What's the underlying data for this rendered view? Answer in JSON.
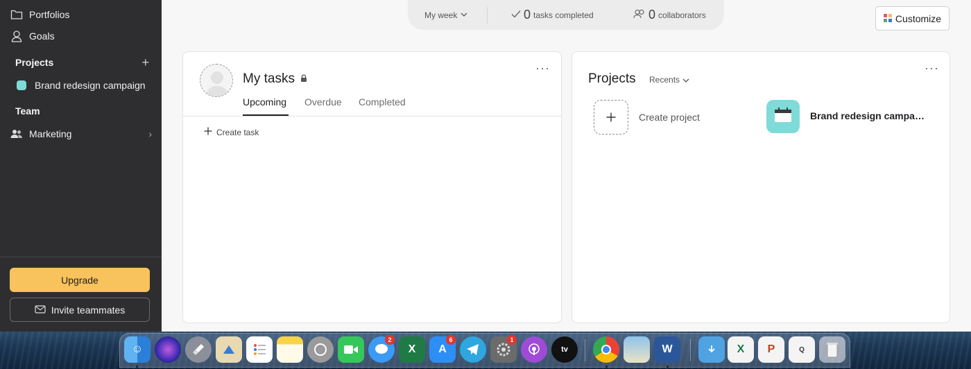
{
  "sidebar": {
    "portfolios": "Portfolios",
    "goals": "Goals",
    "projects_heading": "Projects",
    "project_item": "Brand redesign campaign",
    "team_heading": "Team",
    "team_item": "Marketing",
    "upgrade": "Upgrade",
    "invite": "Invite teammates"
  },
  "stats": {
    "period": "My week",
    "tasks_count": "0",
    "tasks_label": "tasks completed",
    "collab_count": "0",
    "collab_label": "collaborators"
  },
  "customize": "Customize",
  "my_tasks": {
    "title": "My tasks",
    "tabs": [
      "Upcoming",
      "Overdue",
      "Completed"
    ],
    "create_task": "Create task"
  },
  "projects_card": {
    "title": "Projects",
    "filter": "Recents",
    "create": "Create project",
    "project_name": "Brand redesign campaign",
    "project_color": "#7fdbd8"
  },
  "dock": {
    "badges": {
      "messages": "2",
      "app_store": "6",
      "system_prefs": "1"
    },
    "apps": [
      "finder-icon",
      "siri-icon",
      "launchpad-icon",
      "mail-icon",
      "reminders-icon",
      "notes-icon",
      "whatsapp-icon",
      "facetime-icon",
      "messages-icon",
      "excel-icon",
      "app-store-icon",
      "telegram-icon",
      "system-preferences-icon",
      "podcasts-icon",
      "apple-tv-icon",
      "chrome-icon",
      "preview-icon",
      "word-icon",
      "downloads-folder-icon",
      "excel-doc-icon",
      "powerpoint-doc-icon",
      "mpeg-doc-icon",
      "trash-icon"
    ]
  }
}
